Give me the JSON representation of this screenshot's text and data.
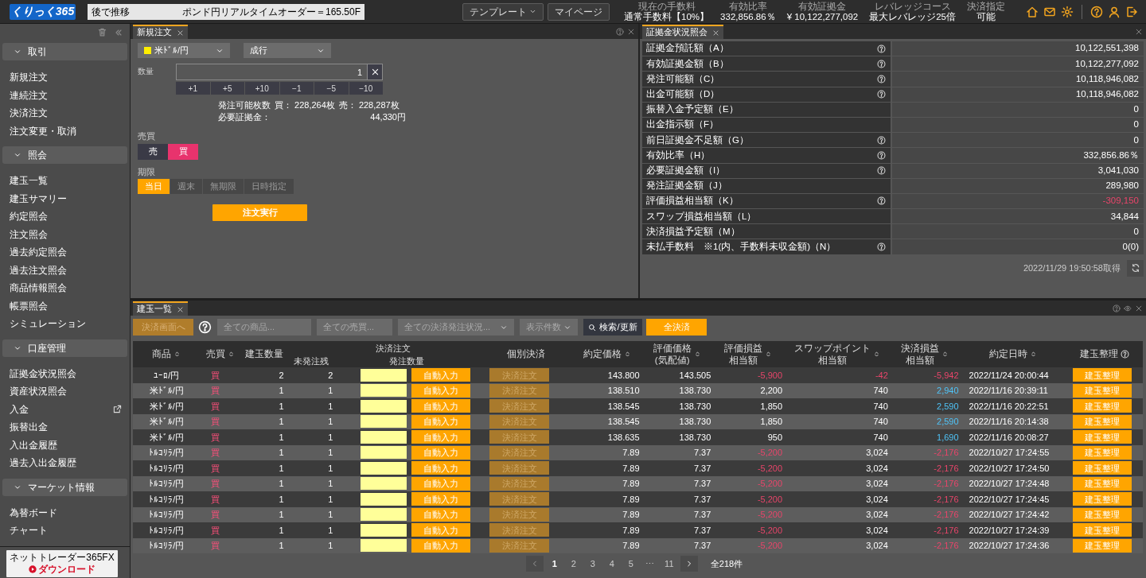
{
  "header": {
    "logo": "くりっく365",
    "ticker_left": "後で推移",
    "ticker": "ポンド円リアルタイムオーダー＝165.50F",
    "buttons": [
      {
        "label": "テンプレート",
        "dropdown": true
      },
      {
        "label": "マイページ",
        "dropdown": false
      }
    ],
    "stats": [
      {
        "label": "現在の手数料",
        "value": "通常手数料【10%】"
      },
      {
        "label": "有効比率",
        "value": "332,856.86％"
      },
      {
        "label": "有効証拠金",
        "value": "¥ 10,122,277,092"
      },
      {
        "label": "レバレッジコース",
        "value": "最大レバレッジ25倍"
      },
      {
        "label": "決済指定",
        "value": "可能"
      }
    ]
  },
  "sidebar": {
    "sections": [
      {
        "title": "取引",
        "expanded": true,
        "items": [
          {
            "label": "新規注文",
            "external": false
          },
          {
            "label": "連続注文",
            "external": false
          },
          {
            "label": "決済注文",
            "external": false
          },
          {
            "label": "注文変更・取消",
            "external": false
          }
        ]
      },
      {
        "title": "照会",
        "expanded": true,
        "items": [
          {
            "label": "建玉一覧",
            "external": false
          },
          {
            "label": "建玉サマリー",
            "external": false
          },
          {
            "label": "約定照会",
            "external": false
          },
          {
            "label": "注文照会",
            "external": false
          },
          {
            "label": "過去約定照会",
            "external": false
          },
          {
            "label": "過去注文照会",
            "external": false
          },
          {
            "label": "商品情報照会",
            "external": false
          },
          {
            "label": "帳票照会",
            "external": false
          },
          {
            "label": "シミュレーション",
            "external": false
          }
        ]
      },
      {
        "title": "口座管理",
        "expanded": true,
        "items": [
          {
            "label": "証拠金状況照会",
            "external": false
          },
          {
            "label": "資産状況照会",
            "external": false
          },
          {
            "label": "入金",
            "external": true
          },
          {
            "label": "振替出金",
            "external": false
          },
          {
            "label": "入出金履歴",
            "external": false
          },
          {
            "label": "過去入出金履歴",
            "external": false
          }
        ]
      },
      {
        "title": "マーケット情報",
        "expanded": true,
        "items": [
          {
            "label": "為替ボード",
            "external": false
          },
          {
            "label": "チャート",
            "external": false
          }
        ]
      }
    ],
    "banner": {
      "title": "ネットトレーダー365FX",
      "action": "ダウンロード"
    }
  },
  "order_panel": {
    "tab": "新規注文",
    "symbol": {
      "label": "米ﾄﾞﾙ/円",
      "color": "#ffee00"
    },
    "order_type": "成行",
    "quantity_label": "数量",
    "quantity": "1",
    "steps": [
      "+1",
      "+5",
      "+10",
      "−1",
      "−5",
      "−10"
    ],
    "available": {
      "label": "発注可能枚数",
      "buy": "買： 228,264枚",
      "sell": "売： 228,287枚"
    },
    "margin": {
      "label": "必要証拠金：",
      "value": "44,330円"
    },
    "side_label": "売買",
    "sides": [
      {
        "label": "売",
        "kind": "sell",
        "selected": false
      },
      {
        "label": "買",
        "kind": "buy",
        "selected": true
      }
    ],
    "expiry_label": "期限",
    "expiries": [
      {
        "label": "当日",
        "selected": true
      },
      {
        "label": "週末",
        "selected": false
      },
      {
        "label": "無期限",
        "selected": false
      },
      {
        "label": "日時指定",
        "selected": false
      }
    ],
    "submit": "注文実行"
  },
  "account_panel": {
    "tab": "証拠金状況照会",
    "rows": [
      {
        "label": "証拠金預託額（A）",
        "help": true,
        "value": "10,122,551,398",
        "loss": false
      },
      {
        "label": "有効証拠金額（B）",
        "help": true,
        "value": "10,122,277,092",
        "loss": false
      },
      {
        "label": "発注可能額（C）",
        "help": true,
        "value": "10,118,946,082",
        "loss": false
      },
      {
        "label": "出金可能額（D）",
        "help": true,
        "value": "10,118,946,082",
        "loss": false
      },
      {
        "label": "振替入金予定額（E）",
        "help": false,
        "value": "0",
        "loss": false
      },
      {
        "label": "出金指示額（F）",
        "help": false,
        "value": "0",
        "loss": false
      },
      {
        "label": "前日証拠金不足額（G）",
        "help": true,
        "value": "0",
        "loss": false
      },
      {
        "label": "有効比率（H）",
        "help": true,
        "value": "332,856.86％",
        "loss": false
      },
      {
        "label": "必要証拠金額（I）",
        "help": true,
        "value": "3,041,030",
        "loss": false
      },
      {
        "label": "発注証拠金額（J）",
        "help": false,
        "value": "289,980",
        "loss": false
      },
      {
        "label": "評価損益相当額（K）",
        "help": true,
        "value": "-309,150",
        "loss": true
      },
      {
        "label": "スワップ損益相当額（L）",
        "help": false,
        "value": "34,844",
        "loss": false
      },
      {
        "label": "決済損益予定額（M）",
        "help": false,
        "value": "0",
        "loss": false
      },
      {
        "label": "未払手数料　※1(内、手数料未収金額)（N）",
        "help": true,
        "value": "0(0)",
        "loss": false
      }
    ],
    "timestamp": "2022/11/29 19:50:58取得"
  },
  "positions_panel": {
    "tab": "建玉一覧",
    "toolbar": {
      "close_screen": {
        "label": "決済画面へ",
        "disabled": true
      },
      "filters": [
        {
          "placeholder": "全ての商品...",
          "dropdown": false
        },
        {
          "placeholder": "全ての売買...",
          "dropdown": false
        },
        {
          "placeholder": "全ての決済発注状況...",
          "dropdown": true
        },
        {
          "placeholder": "表示件数",
          "dropdown": true
        }
      ],
      "search": "検索/更新",
      "close_all": "全決済"
    },
    "columns": [
      {
        "label": "商品",
        "sortable": true
      },
      {
        "label": "売買",
        "sortable": true
      },
      {
        "label": "建玉数量",
        "sortable": false
      },
      {
        "label": "決済注文",
        "children": [
          {
            "label": "未発注残"
          },
          {
            "label": "発注数量"
          }
        ]
      },
      {
        "label": "個別決済",
        "sortable": false
      },
      {
        "label": "約定価格",
        "sortable": true
      },
      {
        "label": "評価価格",
        "sublabel": "(気配値)",
        "sortable": true
      },
      {
        "label": "評価損益",
        "sublabel": "相当額",
        "sortable": true
      },
      {
        "label": "スワップポイント",
        "sublabel": "相当額",
        "sortable": true
      },
      {
        "label": "決済損益",
        "sublabel": "相当額",
        "sortable": true
      },
      {
        "label": "約定日時",
        "sortable": true
      },
      {
        "label": "建玉整理",
        "sortable": false,
        "help": true
      }
    ],
    "rows": [
      {
        "product": "ﾕｰﾛ/円",
        "side": "買",
        "quantity": "2",
        "unfilled": "2",
        "auto": "自動入力",
        "close": "決済注文",
        "close_disabled": true,
        "price": "143.800",
        "eval_price": "143.505",
        "pnl": {
          "value": "-5,900",
          "loss": true
        },
        "swap": {
          "value": "-42",
          "loss": true
        },
        "settle": {
          "value": "-5,942",
          "loss": true
        },
        "datetime": "2022/11/24 20:00:44",
        "manage": "建玉整理"
      },
      {
        "product": "米ﾄﾞﾙ/円",
        "side": "買",
        "quantity": "1",
        "unfilled": "1",
        "auto": "自動入力",
        "close": "決済注文",
        "close_disabled": true,
        "price": "138.510",
        "eval_price": "138.730",
        "pnl": {
          "value": "2,200",
          "loss": false
        },
        "swap": {
          "value": "740",
          "loss": false
        },
        "settle": {
          "value": "2,940",
          "loss": false
        },
        "datetime": "2022/11/16 20:39:11",
        "manage": "建玉整理"
      },
      {
        "product": "米ﾄﾞﾙ/円",
        "side": "買",
        "quantity": "1",
        "unfilled": "1",
        "auto": "自動入力",
        "close": "決済注文",
        "close_disabled": true,
        "price": "138.545",
        "eval_price": "138.730",
        "pnl": {
          "value": "1,850",
          "loss": false
        },
        "swap": {
          "value": "740",
          "loss": false
        },
        "settle": {
          "value": "2,590",
          "loss": false
        },
        "datetime": "2022/11/16 20:22:51",
        "manage": "建玉整理"
      },
      {
        "product": "米ﾄﾞﾙ/円",
        "side": "買",
        "quantity": "1",
        "unfilled": "1",
        "auto": "自動入力",
        "close": "決済注文",
        "close_disabled": true,
        "price": "138.545",
        "eval_price": "138.730",
        "pnl": {
          "value": "1,850",
          "loss": false
        },
        "swap": {
          "value": "740",
          "loss": false
        },
        "settle": {
          "value": "2,590",
          "loss": false
        },
        "datetime": "2022/11/16 20:14:38",
        "manage": "建玉整理"
      },
      {
        "product": "米ﾄﾞﾙ/円",
        "side": "買",
        "quantity": "1",
        "unfilled": "1",
        "auto": "自動入力",
        "close": "決済注文",
        "close_disabled": true,
        "price": "138.635",
        "eval_price": "138.730",
        "pnl": {
          "value": "950",
          "loss": false
        },
        "swap": {
          "value": "740",
          "loss": false
        },
        "settle": {
          "value": "1,690",
          "loss": false
        },
        "datetime": "2022/11/16 20:08:27",
        "manage": "建玉整理"
      },
      {
        "product": "ﾄﾙｺﾘﾗ/円",
        "side": "買",
        "quantity": "1",
        "unfilled": "1",
        "auto": "自動入力",
        "close": "決済注文",
        "close_disabled": true,
        "price": "7.89",
        "eval_price": "7.37",
        "pnl": {
          "value": "-5,200",
          "loss": true
        },
        "swap": {
          "value": "3,024",
          "loss": false
        },
        "settle": {
          "value": "-2,176",
          "loss": true
        },
        "datetime": "2022/10/27 17:24:55",
        "manage": "建玉整理"
      },
      {
        "product": "ﾄﾙｺﾘﾗ/円",
        "side": "買",
        "quantity": "1",
        "unfilled": "1",
        "auto": "自動入力",
        "close": "決済注文",
        "close_disabled": true,
        "price": "7.89",
        "eval_price": "7.37",
        "pnl": {
          "value": "-5,200",
          "loss": true
        },
        "swap": {
          "value": "3,024",
          "loss": false
        },
        "settle": {
          "value": "-2,176",
          "loss": true
        },
        "datetime": "2022/10/27 17:24:50",
        "manage": "建玉整理"
      },
      {
        "product": "ﾄﾙｺﾘﾗ/円",
        "side": "買",
        "quantity": "1",
        "unfilled": "1",
        "auto": "自動入力",
        "close": "決済注文",
        "close_disabled": true,
        "price": "7.89",
        "eval_price": "7.37",
        "pnl": {
          "value": "-5,200",
          "loss": true
        },
        "swap": {
          "value": "3,024",
          "loss": false
        },
        "settle": {
          "value": "-2,176",
          "loss": true
        },
        "datetime": "2022/10/27 17:24:48",
        "manage": "建玉整理"
      },
      {
        "product": "ﾄﾙｺﾘﾗ/円",
        "side": "買",
        "quantity": "1",
        "unfilled": "1",
        "auto": "自動入力",
        "close": "決済注文",
        "close_disabled": true,
        "price": "7.89",
        "eval_price": "7.37",
        "pnl": {
          "value": "-5,200",
          "loss": true
        },
        "swap": {
          "value": "3,024",
          "loss": false
        },
        "settle": {
          "value": "-2,176",
          "loss": true
        },
        "datetime": "2022/10/27 17:24:45",
        "manage": "建玉整理"
      },
      {
        "product": "ﾄﾙｺﾘﾗ/円",
        "side": "買",
        "quantity": "1",
        "unfilled": "1",
        "auto": "自動入力",
        "close": "決済注文",
        "close_disabled": true,
        "price": "7.89",
        "eval_price": "7.37",
        "pnl": {
          "value": "-5,200",
          "loss": true
        },
        "swap": {
          "value": "3,024",
          "loss": false
        },
        "settle": {
          "value": "-2,176",
          "loss": true
        },
        "datetime": "2022/10/27 17:24:42",
        "manage": "建玉整理"
      },
      {
        "product": "ﾄﾙｺﾘﾗ/円",
        "side": "買",
        "quantity": "1",
        "unfilled": "1",
        "auto": "自動入力",
        "close": "決済注文",
        "close_disabled": true,
        "price": "7.89",
        "eval_price": "7.37",
        "pnl": {
          "value": "-5,200",
          "loss": true
        },
        "swap": {
          "value": "3,024",
          "loss": false
        },
        "settle": {
          "value": "-2,176",
          "loss": true
        },
        "datetime": "2022/10/27 17:24:39",
        "manage": "建玉整理"
      },
      {
        "product": "ﾄﾙｺﾘﾗ/円",
        "side": "買",
        "quantity": "1",
        "unfilled": "1",
        "auto": "自動入力",
        "close": "決済注文",
        "close_disabled": true,
        "price": "7.89",
        "eval_price": "7.37",
        "pnl": {
          "value": "-5,200",
          "loss": true
        },
        "swap": {
          "value": "3,024",
          "loss": false
        },
        "settle": {
          "value": "-2,176",
          "loss": true
        },
        "datetime": "2022/10/27 17:24:36",
        "manage": "建玉整理"
      }
    ],
    "pagination": {
      "pages": [
        {
          "label": "1",
          "selected": true
        },
        {
          "label": "2",
          "selected": false
        },
        {
          "label": "3",
          "selected": false
        },
        {
          "label": "4",
          "selected": false
        },
        {
          "label": "5",
          "selected": false
        },
        {
          "label": "⋯",
          "selected": false
        },
        {
          "label": "11",
          "selected": false
        }
      ],
      "total": "全218件"
    }
  }
}
